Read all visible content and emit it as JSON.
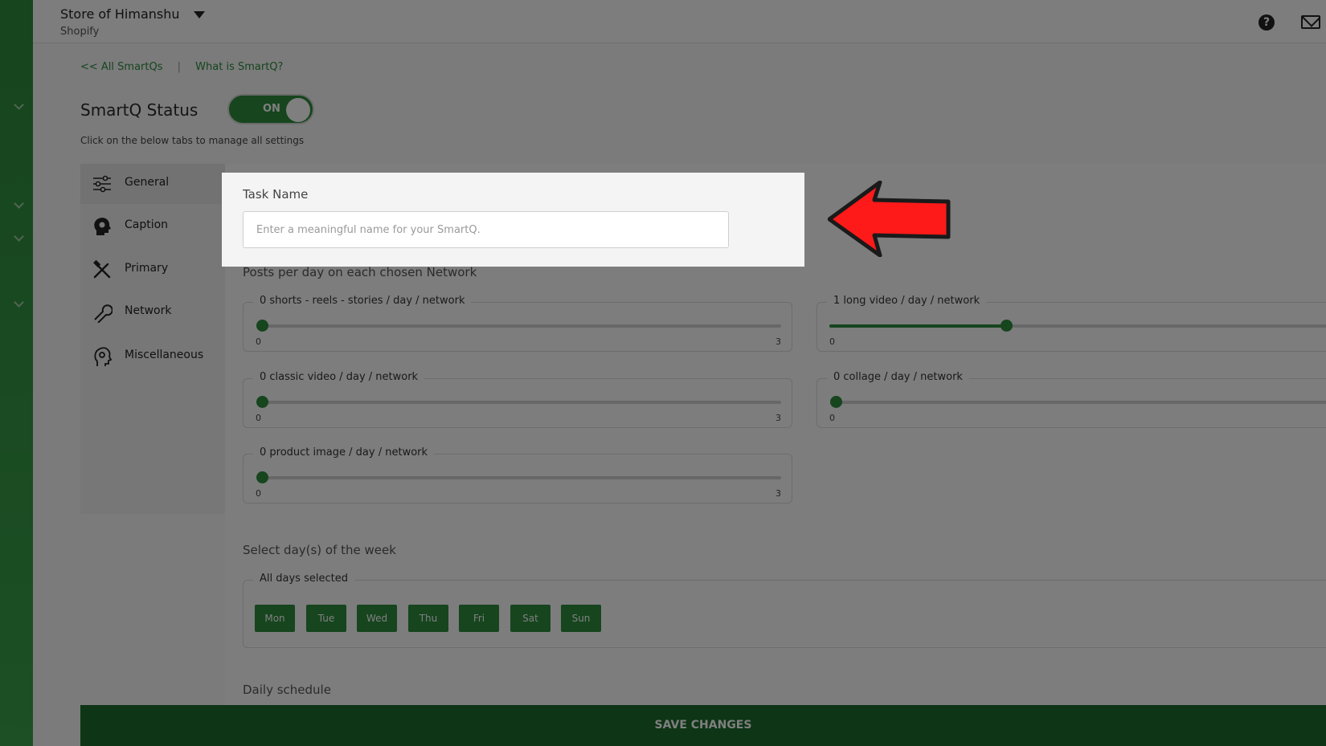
{
  "header": {
    "store_name": "Store of Himanshu",
    "platform": "Shopify"
  },
  "breadcrumb": {
    "all_smartqs": "<< All SmartQs",
    "separator": "|",
    "what_is": "What is SmartQ?"
  },
  "status": {
    "title": "SmartQ Status",
    "toggle_label": "ON",
    "hint": "Click on the below tabs to manage all settings"
  },
  "tabs": [
    {
      "label": "General",
      "icon": "sliders-icon",
      "active": true
    },
    {
      "label": "Caption",
      "icon": "head-gear-icon"
    },
    {
      "label": "Primary",
      "icon": "tools-icon"
    },
    {
      "label": "Network",
      "icon": "wrench-icon"
    },
    {
      "label": "Miscellaneous",
      "icon": "settings-head-icon"
    }
  ],
  "task_name": {
    "label": "Task Name",
    "placeholder": "Enter a meaningful name for your SmartQ.",
    "value": ""
  },
  "posts": {
    "title": "Posts per day on each chosen Network",
    "sliders": [
      {
        "label": "0 shorts - reels - stories / day / network",
        "value": 0,
        "min": "0",
        "max": "3"
      },
      {
        "label": "1 long video / day / network",
        "value": 1,
        "min": "0",
        "max": "3"
      },
      {
        "label": "0 classic video / day / network",
        "value": 0,
        "min": "0",
        "max": "3"
      },
      {
        "label": "0 collage / day / network",
        "value": 0,
        "min": "0",
        "max": "3"
      },
      {
        "label": "0 product image / day / network",
        "value": 0,
        "min": "0",
        "max": "3"
      }
    ]
  },
  "week": {
    "title": "Select day(s) of the week",
    "legend": "All days selected",
    "days": [
      "Mon",
      "Tue",
      "Wed",
      "Thu",
      "Fri",
      "Sat",
      "Sun"
    ]
  },
  "schedule": {
    "title": "Daily schedule"
  },
  "save_label": "SAVE CHANGES",
  "colors": {
    "accent": "#2c8a3c",
    "save_bar": "#1a6b2c",
    "arrow": "#ff1a1a"
  }
}
